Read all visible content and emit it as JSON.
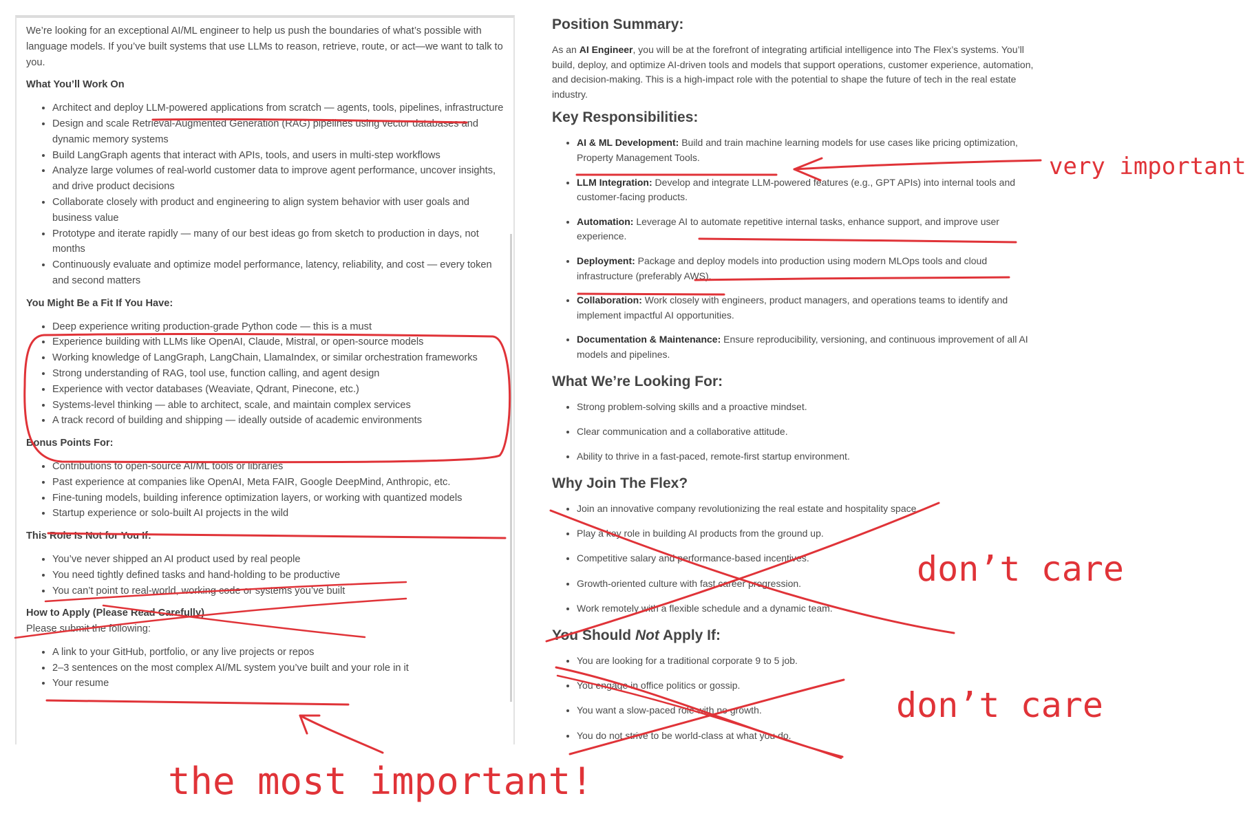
{
  "left": {
    "intro": "We’re looking for an exceptional AI/ML engineer to help us push the boundaries of what’s possible with language models. If you’ve built systems that use LLMs to reason, retrieve, route, or act—we want to talk to you.",
    "work_title": "What You’ll Work On",
    "work_items": [
      "Architect and deploy LLM-powered applications from scratch — agents, tools, pipelines, infrastructure",
      "Design and scale Retrieval-Augmented Generation (RAG) pipelines using vector databases and dynamic memory systems",
      "Build LangGraph agents that interact with APIs, tools, and users in multi-step workflows",
      "Analyze large volumes of real-world customer data to improve agent performance, uncover insights, and drive product decisions",
      "Collaborate closely with product and engineering to align system behavior with user goals and business value",
      "Prototype and iterate rapidly — many of our best ideas go from sketch to production in days, not months",
      "Continuously evaluate and optimize model performance, latency, reliability, and cost — every token and second matters"
    ],
    "fit_title": "You Might Be a Fit If You Have:",
    "fit_items": [
      "Deep experience writing production-grade Python code — this is a must",
      "Experience building with LLMs like OpenAI, Claude, Mistral, or open-source models",
      "Working knowledge of LangGraph, LangChain, LlamaIndex, or similar orchestration frameworks",
      "Strong understanding of RAG, tool use, function calling, and agent design",
      "Experience with vector databases (Weaviate, Qdrant, Pinecone, etc.)",
      "Systems-level thinking — able to architect, scale, and maintain complex services",
      "A track record of building and shipping — ideally outside of academic environments"
    ],
    "bonus_title": "Bonus Points For:",
    "bonus_items": [
      "Contributions to open-source AI/ML tools or libraries",
      "Past experience at companies like OpenAI, Meta FAIR, Google DeepMind, Anthropic, etc.",
      "Fine-tuning models, building inference optimization layers, or working with quantized models",
      "Startup experience or solo-built AI projects in the wild"
    ],
    "not_title": "This Role Is Not for You If:",
    "not_items": [
      "You’ve never shipped an AI product used by real people",
      "You need tightly defined tasks and hand-holding to be productive",
      "You can’t point to real-world, working code or systems you’ve built"
    ],
    "apply_title": "How to Apply (Please Read Carefully)",
    "apply_subtitle": "Please submit the following:",
    "apply_items": [
      "A link to your GitHub, portfolio, or any live projects or repos",
      "2–3 sentences on the most complex AI/ML system you’ve built and your role in it",
      "Your resume"
    ]
  },
  "right": {
    "summary_title": "Position Summary:",
    "summary_pre": "As an ",
    "summary_bold": "AI Engineer",
    "summary_post": ", you will be at the forefront of integrating artificial intelligence into The Flex’s systems. You’ll build, deploy, and optimize AI-driven tools and models that support operations, customer experience, automation, and decision-making. This is a high-impact role with the potential to shape the future of tech in the real estate industry.",
    "resp_title": "Key Responsibilities:",
    "resp_items": [
      {
        "label": "AI & ML Development:",
        "text": " Build and train machine learning models for use cases like pricing optimization, Property Management Tools."
      },
      {
        "label": "LLM Integration:",
        "text": " Develop and integrate LLM-powered features (e.g., GPT APIs) into internal tools and customer-facing products."
      },
      {
        "label": "Automation:",
        "text": " Leverage AI to automate repetitive internal tasks, enhance support, and improve user experience."
      },
      {
        "label": "Deployment:",
        "text": " Package and deploy models into production using modern MLOps tools and cloud infrastructure (preferably AWS)."
      },
      {
        "label": "Collaboration:",
        "text": " Work closely with engineers, product managers, and operations teams to identify and implement impactful AI opportunities."
      },
      {
        "label": "Documentation & Maintenance:",
        "text": " Ensure reproducibility, versioning, and continuous improvement of all AI models and pipelines."
      }
    ],
    "looking_title": "What We’re Looking For:",
    "looking_items": [
      "Strong problem-solving skills and a proactive mindset.",
      "Clear communication and a collaborative attitude.",
      "Ability to thrive in a fast-paced, remote-first startup environment."
    ],
    "why_title": "Why Join The Flex?",
    "why_items": [
      "Join an innovative company revolutionizing the real estate and hospitality space.",
      "Play a key role in building AI products from the ground up.",
      "Competitive salary and performance-based incentives.",
      "Growth-oriented culture with fast career progression.",
      "Work remotely with a flexible schedule and a dynamic team."
    ],
    "notapply_title_pre": "You Should ",
    "notapply_title_em": "Not",
    "notapply_title_post": " Apply If:",
    "notapply_items": [
      "You are looking for a traditional corporate 9 to 5 job.",
      "You engage in office politics or gossip.",
      "You want a slow-paced role with no growth.",
      "You do not strive to be world-class at what you do."
    ]
  },
  "annotations": {
    "very_important": "very important",
    "dont_care_1": "don’t care",
    "dont_care_2": "don’t care",
    "most_important": "the most important!",
    "color": "#e03338"
  }
}
